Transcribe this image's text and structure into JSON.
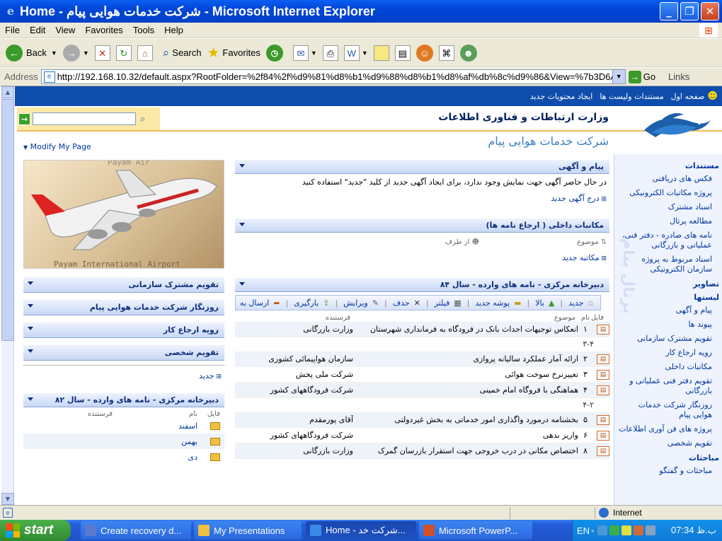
{
  "window": {
    "title": "Home - شرکت خدمات هوایی پیام - Microsoft Internet Explorer"
  },
  "menu": [
    "File",
    "Edit",
    "View",
    "Favorites",
    "Tools",
    "Help"
  ],
  "toolbar": {
    "back": "Back",
    "search": "Search",
    "favorites": "Favorites"
  },
  "address": {
    "label": "Address",
    "url": "http://192.168.10.32/default.aspx?RootFolder=%2f84%2f%d9%81%d8%b1%d9%88%d8%b1%d8%af%db%8c%d9%86&View=%7b3D6A62",
    "go": "Go",
    "links": "Links"
  },
  "topnav": {
    "items": [
      "صفحه اول",
      "مستندات ولیست ها",
      "ایجاد محتویات جدید"
    ]
  },
  "header": {
    "modify": "Modify My Page",
    "ministry": "وزارت ارتباطات و فناوری اطلاعات",
    "company": "شرکت خدمات هوایی پیام"
  },
  "photo": {
    "caption_top": "Payam Air",
    "caption_bottom": "Payam International Airport"
  },
  "leftnav": {
    "sections": [
      {
        "title": "مستندات",
        "items": [
          "فکس های دریافتی",
          "پروژه مکاتبات الکترونیکی",
          "اسناد مشترک",
          "مطالعه پرتال",
          "نامه های صادره - دفتر فنی، عملیاتی و بازرگانی",
          "اسناد مربوط به پروژه سازمان الکترونیکی"
        ]
      },
      {
        "title": "تصاویر",
        "items": []
      },
      {
        "title": "لیستها",
        "items": [
          "پیام و آگهی",
          "پیوند ها",
          "تقویم مشترک سازمانی",
          "رویه ارجاع کار",
          "مکاتبات داخلی",
          "تقویم دفتر فنی عملیاتی و بازرگانی",
          "روزنگار شرکت خدمات هوایی پیام",
          "پروژه های فن آوری اطلاعات",
          "تقویم شخصی"
        ]
      },
      {
        "title": "مباحثات",
        "items": [
          "مباحثات و گفتگو"
        ]
      }
    ]
  },
  "announcements": {
    "title": "پیام و آگهی",
    "text": "در حال حاضر آگهی جهت نمایش وجود ندارد، برای ایجاد آگهی جدید از کلید \"جدید\" استفاده کنید",
    "add": "درج آگهی جدید"
  },
  "internal": {
    "title": "مکاتبات داخلی ( ارجاع نامه ها)",
    "col_subject": "موضوع",
    "col_from": "از طرف",
    "add": "مکاتبه جدید"
  },
  "inbox84": {
    "title": "دبیرخانه مرکزی - نامه های وارده - سال ۸۴",
    "toolbar": [
      "جدید",
      "بالا",
      "پوشه جدید",
      "فیلتر",
      "حذف",
      "ویرایش",
      "بارگیری",
      "ارسال به"
    ],
    "cols": {
      "file": "فایل",
      "name": "نام",
      "subject": "موضوع",
      "sender": "فرستنده"
    },
    "rows": [
      {
        "type": "item",
        "no": "۱",
        "subject": "انعکاس توجیهات احداث بانک در فرودگاه به فرمانداری شهرستان",
        "sender": "وزارت بازرگانی"
      },
      {
        "type": "group",
        "label": "۳-۴"
      },
      {
        "type": "item",
        "no": "۲",
        "subject": "ارائه آمار عملکرد سالیانه پروازی",
        "sender": "سازمان هواپیمائی کشوری"
      },
      {
        "type": "item",
        "no": "۳",
        "subject": "تغییرنرخ سوخت هوائی",
        "sender": "شرکت ملی پخش"
      },
      {
        "type": "item",
        "no": "۴",
        "subject": "هماهنگی با فروگاه امام خمینی",
        "sender": "شرکت فرودگاههای کشور"
      },
      {
        "type": "group",
        "label": "۴-۲"
      },
      {
        "type": "item",
        "no": "۵",
        "subject": "بخشنامه درمورد واگذاری امور خدماتی به بخش غیردولتی",
        "sender": "آقای پورمقدم"
      },
      {
        "type": "item",
        "no": "۶",
        "subject": "واریز بدهی",
        "sender": "شرکت فرودگاههای کشور"
      },
      {
        "type": "item",
        "no": "۸",
        "subject": "اختصاص مکانی در درب خروجی جهت استقرار بازرسان گمرک",
        "sender": "وزارت بازرگانی"
      }
    ]
  },
  "leftparts": [
    "تقویم مشترک سازمانی",
    "روزنگار شرکت خدمات هوایی پیام",
    "رویه ارجاع کار",
    "تقویم شخصی"
  ],
  "leftnew": "جدید",
  "inbox82": {
    "title": "دبیرخانه مرکزی - نامه های وارده - سال ۸۲",
    "col_file": "فایل",
    "col_name": "نام",
    "col_sender": "فرستنده",
    "rows": [
      "اسفند",
      "بهمن",
      "دی"
    ]
  },
  "status": {
    "zone": "Internet"
  },
  "taskbar": {
    "start": "start",
    "tasks": [
      "Create recovery d...",
      "My Presentations",
      "Home - شرکت خد...",
      "Microsoft PowerP..."
    ],
    "lang": "EN",
    "clock": "07:34 ب.ظ"
  },
  "colors": {
    "xp_blue": "#0046d8",
    "sp_nav": "#0f4dac",
    "link": "#00359c"
  }
}
